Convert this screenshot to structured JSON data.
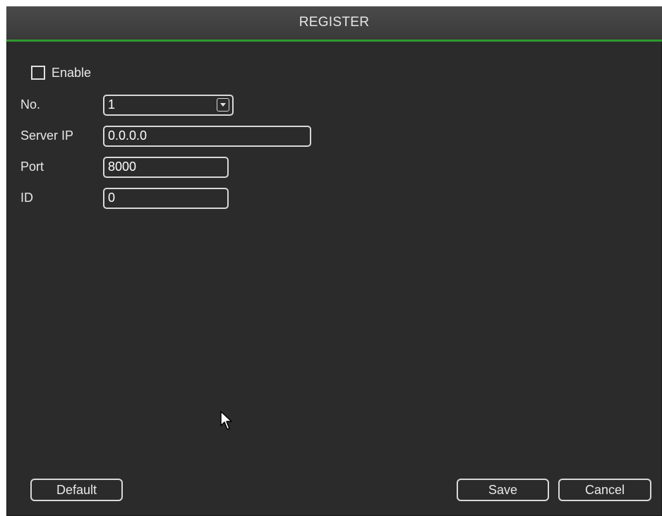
{
  "window": {
    "title": "REGISTER"
  },
  "form": {
    "enable_label": "Enable",
    "enable_checked": false,
    "no_label": "No.",
    "no_value": "1",
    "server_ip_label": "Server IP",
    "server_ip_value": "0.0.0.0",
    "port_label": "Port",
    "port_value": "8000",
    "id_label": "ID",
    "id_value": "0"
  },
  "buttons": {
    "default_label": "Default",
    "save_label": "Save",
    "cancel_label": "Cancel"
  },
  "icons": {
    "dropdown": "chevron-down-icon",
    "pointer": "mouse-pointer-icon"
  },
  "colors": {
    "background": "#2b2b2b",
    "accent": "#2e9a2e",
    "text": "#e8e8e8"
  }
}
